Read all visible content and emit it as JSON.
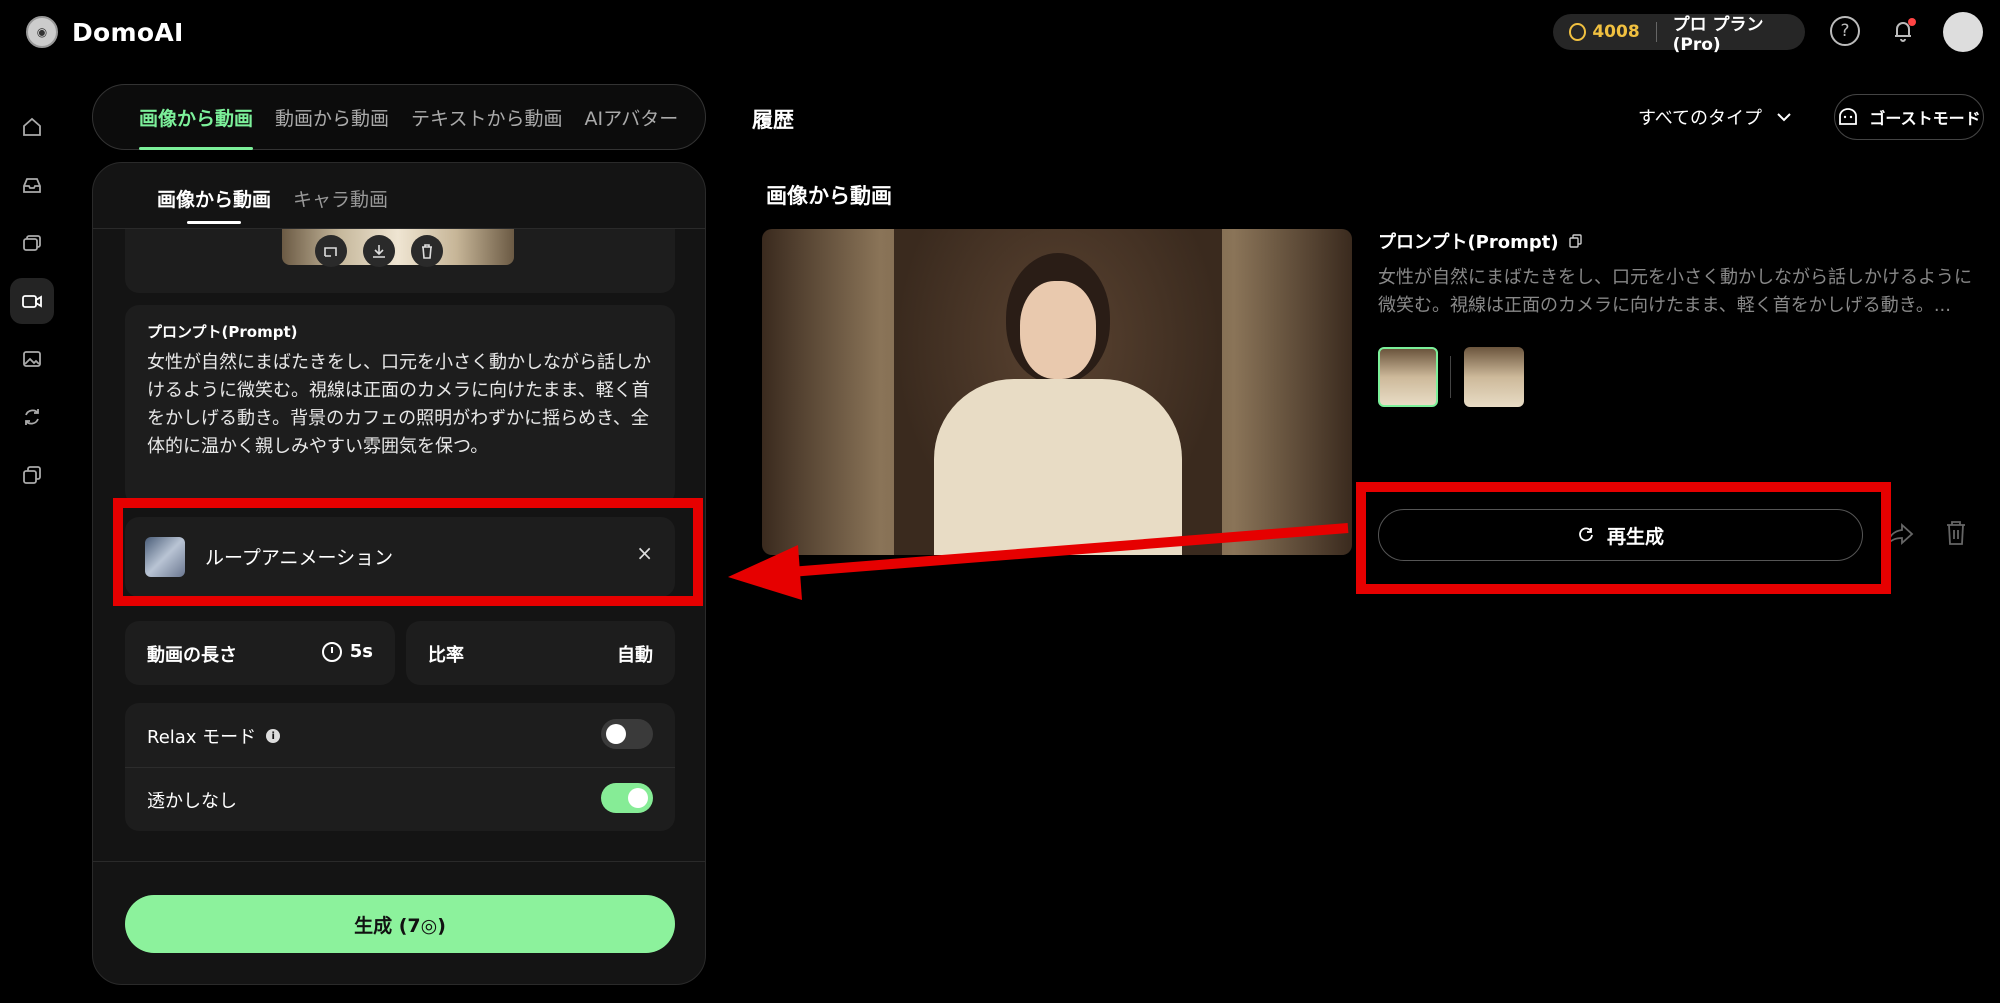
{
  "app": {
    "name": "DomoAI"
  },
  "header": {
    "credits": "4008",
    "plan": "プロ プラン(Pro)",
    "help": "?"
  },
  "sidebar": {
    "items": [
      "home-icon",
      "inbox-icon",
      "layers-icon",
      "video-icon",
      "image-icon",
      "refresh-icon",
      "copy-icon"
    ],
    "active_index": 3
  },
  "top_tabs": [
    "画像から動画",
    "動画から動画",
    "テキストから動画",
    "AIアバター"
  ],
  "sub_tabs": [
    "画像から動画",
    "キャラ動画"
  ],
  "prompt": {
    "title": "プロンプト(Prompt)",
    "text": "女性が自然にまばたきをし、口元を小さく動かしながら話しかけるように微笑む。視線は正面のカメラに向けたまま、軽く首をかしげる動き。背景のカフェの照明がわずかに揺らめき、全体的に温かく親しみやすい雰囲気を保つ。"
  },
  "style": {
    "label": "ループアニメーション",
    "close": "×"
  },
  "options": {
    "length_label": "動画の長さ",
    "length_value": "5s",
    "ratio_label": "比率",
    "ratio_value": "自動"
  },
  "toggles": {
    "relax_label": "Relax モード",
    "relax_on": false,
    "watermark_label": "透かしなし",
    "watermark_on": true,
    "info": "i"
  },
  "generate": {
    "label": "生成 (7◎)"
  },
  "history": {
    "title": "履歴",
    "filter": "すべてのタイプ",
    "ghost": "ゴーストモード",
    "section": "画像から動画",
    "prompt_title": "プロンプト(Prompt)",
    "prompt_text": "女性が自然にまばたきをし、口元を小さく動かしながら話しかけるように微笑む。視線は正面のカメラに向けたまま、軽く首をかしげる動き。...",
    "regen": "再生成"
  },
  "colors": {
    "accent": "#7cf09a",
    "button": "#8cf29c",
    "annotation": "#e60000",
    "coin": "#f0c040"
  }
}
